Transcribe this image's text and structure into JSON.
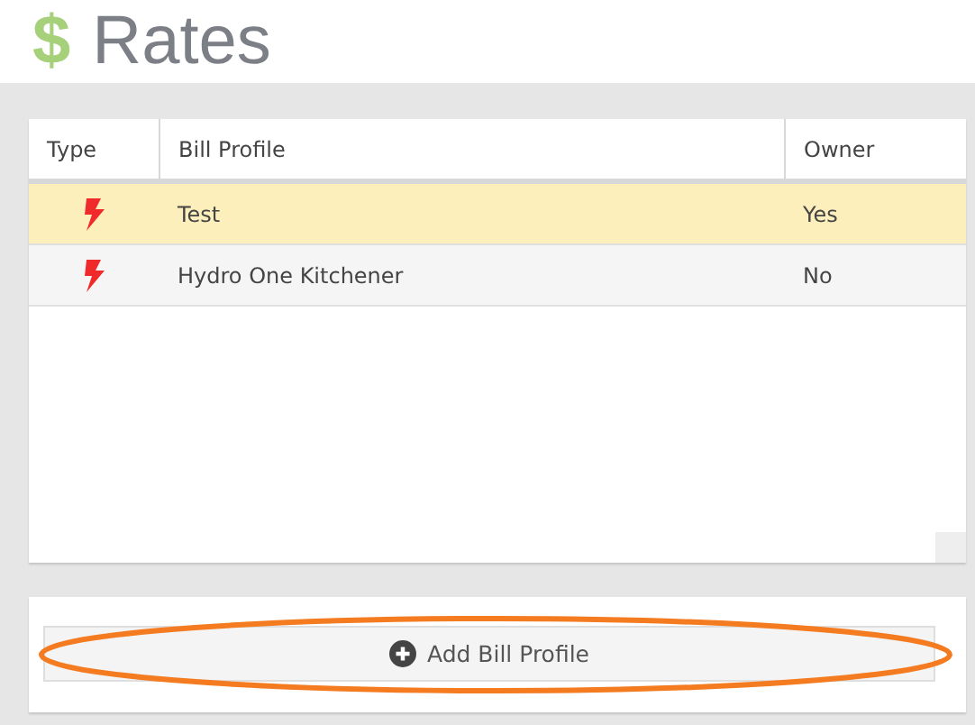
{
  "header": {
    "icon": "$",
    "title": "Rates"
  },
  "table": {
    "columns": [
      "Type",
      "Bill Profile",
      "Owner"
    ],
    "rows": [
      {
        "kind": "electric",
        "bill_profile": "Test",
        "owner": "Yes",
        "selected": true
      },
      {
        "kind": "electric",
        "bill_profile": "Hydro One Kitchener",
        "owner": "No",
        "selected": false
      }
    ]
  },
  "add_button": {
    "label": "Add Bill Profile",
    "highlighted": true
  }
}
